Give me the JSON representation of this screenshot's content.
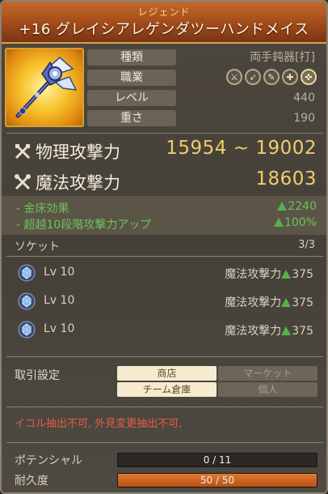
{
  "header": {
    "rarity": "レジェンド",
    "title": "+16 グレイシアレゲンダツーハンドメイス"
  },
  "info": {
    "type_label": "種類",
    "type_value": "両手鈍器[打]",
    "job_label": "職業",
    "level_label": "レベル",
    "level_value": "440",
    "weight_label": "重さ",
    "weight_value": "190",
    "class_icons": [
      "warrior-icon",
      "archer-icon",
      "mage-icon",
      "cleric-icon",
      "academic-icon"
    ]
  },
  "attack": {
    "physical_label": "物理攻撃力",
    "physical_value": "15954 ~ 19002",
    "magic_label": "魔法攻撃力",
    "magic_value": "18603"
  },
  "bonuses": [
    {
      "label": "- 金床効果",
      "value": "2240"
    },
    {
      "label": "- 超越10段階攻撃力アップ",
      "value": "100%"
    }
  ],
  "socket": {
    "title": "ソケット",
    "count": "3/3",
    "items": [
      {
        "level": "Lv 10",
        "stat": "魔法攻撃力",
        "value": "375"
      },
      {
        "level": "Lv 10",
        "stat": "魔法攻撃力",
        "value": "375"
      },
      {
        "level": "Lv 10",
        "stat": "魔法攻撃力",
        "value": "375"
      }
    ]
  },
  "trade": {
    "title": "取引設定",
    "options": [
      {
        "label": "商店",
        "enabled": true
      },
      {
        "label": "マーケット",
        "enabled": false
      },
      {
        "label": "チーム倉庫",
        "enabled": true
      },
      {
        "label": "個人",
        "enabled": false
      }
    ]
  },
  "restriction": "イコル抽出不可, 外見変更抽出不可,",
  "potential": {
    "label": "ポテンシャル",
    "text": "0 / 11",
    "current": 0,
    "max": 11
  },
  "durability": {
    "label": "耐久度",
    "text": "50 / 50",
    "current": 50,
    "max": 50
  },
  "colors": {
    "header_bg": "#a8501c",
    "rarity_text": "#ffd776",
    "attack_value": "#f2cb6a",
    "bonus_green": "#6fc05a",
    "restriction_red": "#ea5a42",
    "durability_fill": "#c8621c"
  }
}
